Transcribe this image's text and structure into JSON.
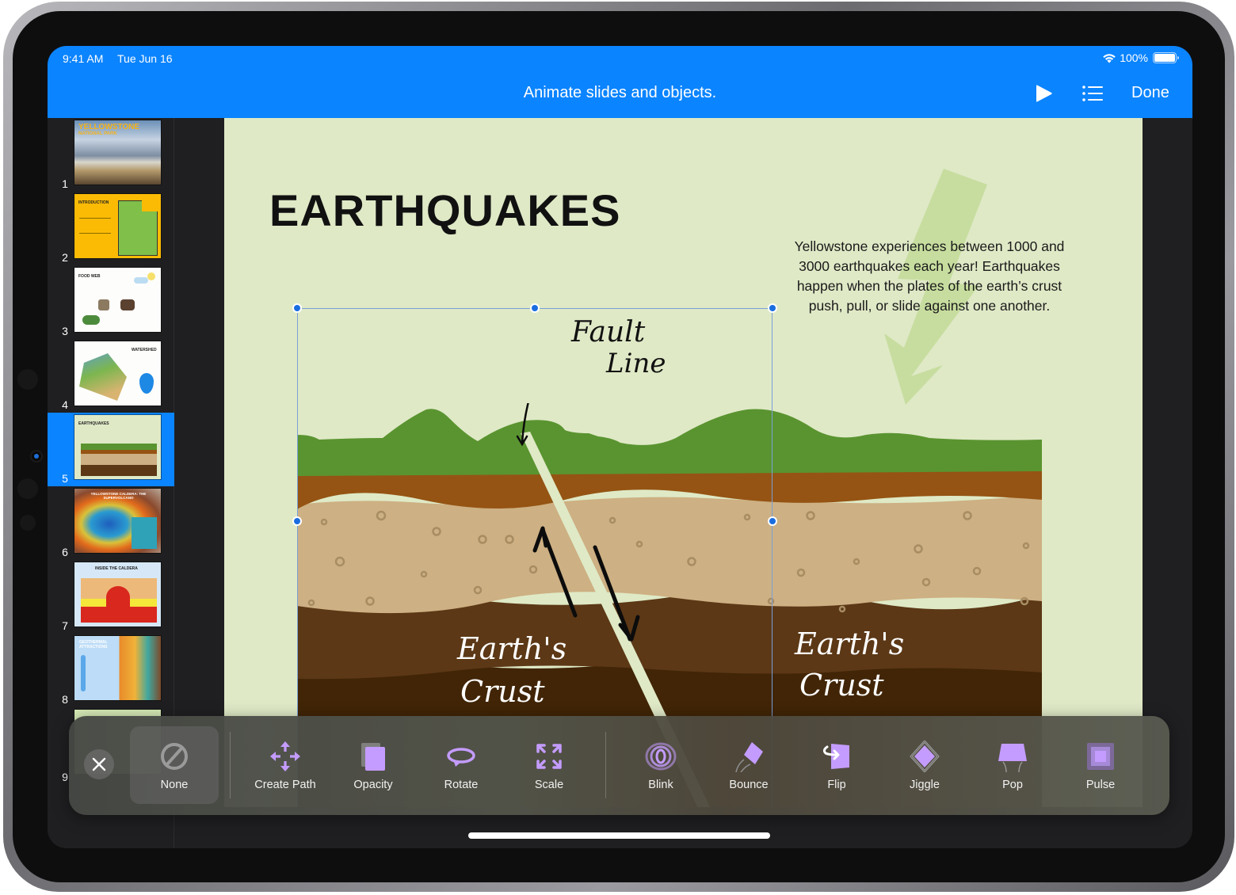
{
  "status_bar": {
    "time": "9:41 AM",
    "date": "Tue Jun 16",
    "battery": "100%",
    "battery_level": 1.0,
    "wifi_icon": "wifi-icon",
    "battery_icon": "battery-icon"
  },
  "toolbar": {
    "title": "Animate slides and objects.",
    "play_icon": "play-icon",
    "outline_icon": "list-icon",
    "done_label": "Done"
  },
  "navigator": {
    "selected_index": 5,
    "slides": [
      {
        "number": "1",
        "title": "YELLOWSTONE",
        "subtitle": "NATIONAL PARK"
      },
      {
        "number": "2",
        "title": "INTRODUCTION"
      },
      {
        "number": "3",
        "title": "FOOD WEB"
      },
      {
        "number": "4",
        "title": "WATERSHED"
      },
      {
        "number": "5",
        "title": "EARTHQUAKES"
      },
      {
        "number": "6",
        "title": "YELLOWSTONE CALDERA: THE SUPERVOLCANO"
      },
      {
        "number": "7",
        "title": "INSIDE THE CALDERA"
      },
      {
        "number": "8",
        "title": "GEOTHERMAL ATTRACTIONS"
      },
      {
        "number": "9",
        "title": ""
      }
    ]
  },
  "slide": {
    "title": "EARTHQUAKES",
    "body": "Yellowstone experiences between 1000 and 3000 earthquakes each year! Earthquakes happen when the plates of the earth’s crust push, pull, or slide against one another.",
    "fault_label_line1": "Fault",
    "fault_label_line2": "Line",
    "crust_left_line1": "Earth's",
    "crust_left_line2": "Crust",
    "crust_right_line1": "Earth's",
    "crust_right_line2": "Crust",
    "colors": {
      "background": "#dfe9c6",
      "grass": "#5a9430",
      "topsoil": "#955413",
      "sand": "#cdb083",
      "dark_soil": "#5c3816",
      "deep_soil": "#412506",
      "fault": "#dfe9c6",
      "bolt": "#c4db9a",
      "selection": "#1a6de0"
    }
  },
  "animation_tray": {
    "close_icon": "close-icon",
    "selected": "None",
    "items": [
      {
        "label": "None",
        "icon": "none-icon"
      },
      {
        "label": "Create Path",
        "icon": "create-path-icon"
      },
      {
        "label": "Opacity",
        "icon": "opacity-icon"
      },
      {
        "label": "Rotate",
        "icon": "rotate-icon"
      },
      {
        "label": "Scale",
        "icon": "scale-icon"
      },
      {
        "label": "Blink",
        "icon": "blink-icon"
      },
      {
        "label": "Bounce",
        "icon": "bounce-icon"
      },
      {
        "label": "Flip",
        "icon": "flip-icon"
      },
      {
        "label": "Jiggle",
        "icon": "jiggle-icon"
      },
      {
        "label": "Pop",
        "icon": "pop-icon"
      },
      {
        "label": "Pulse",
        "icon": "pulse-icon"
      }
    ],
    "accent": "#c49cff"
  },
  "theme": {
    "accent": "#0b84ff"
  }
}
